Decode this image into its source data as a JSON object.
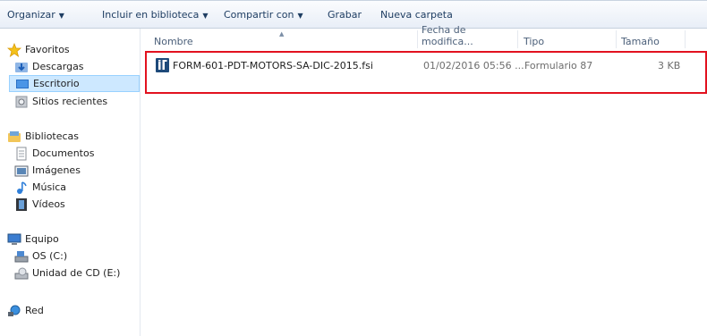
{
  "toolbar": {
    "organize": "Organizar",
    "include_library": "Incluir en biblioteca",
    "share_with": "Compartir con",
    "burn": "Grabar",
    "new_folder": "Nueva carpeta"
  },
  "sidebar": {
    "favorites": "Favoritos",
    "downloads": "Descargas",
    "desktop": "Escritorio",
    "recent": "Sitios recientes",
    "libraries": "Bibliotecas",
    "documents": "Documentos",
    "images": "Imágenes",
    "music": "Música",
    "videos": "Vídeos",
    "computer": "Equipo",
    "drive_c": "OS (C:)",
    "cd_drive": "Unidad de CD (E:)",
    "network": "Red"
  },
  "columns": {
    "name": "Nombre",
    "date": "Fecha de modifica...",
    "type": "Tipo",
    "size": "Tamaño"
  },
  "files": [
    {
      "name": "FORM-601-PDT-MOTORS-SA-DIC-2015.fsi",
      "date": "01/02/2016 05:56 ...",
      "type": "Formulario 87",
      "size": "3 KB",
      "icon": "form-file-icon"
    }
  ],
  "colors": {
    "highlight_border": "#e2121f",
    "selection_bg": "#cde8ff",
    "toolbar_text": "#1e3d62"
  }
}
